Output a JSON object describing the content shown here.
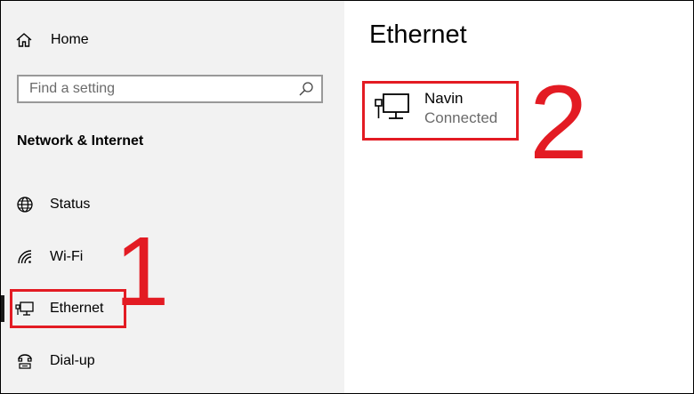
{
  "sidebar": {
    "home_label": "Home",
    "search_placeholder": "Find a setting",
    "section_title": "Network & Internet",
    "items": [
      {
        "label": "Status",
        "icon": "globe-icon"
      },
      {
        "label": "Wi-Fi",
        "icon": "wifi-icon"
      },
      {
        "label": "Ethernet",
        "icon": "ethernet-icon",
        "selected": true
      },
      {
        "label": "Dial-up",
        "icon": "dialup-icon"
      }
    ]
  },
  "main": {
    "title": "Ethernet",
    "network": {
      "name": "Navin",
      "status": "Connected",
      "icon": "ethernet-icon"
    }
  },
  "annotations": {
    "step1": "1",
    "step2": "2",
    "color": "#e31b23"
  }
}
